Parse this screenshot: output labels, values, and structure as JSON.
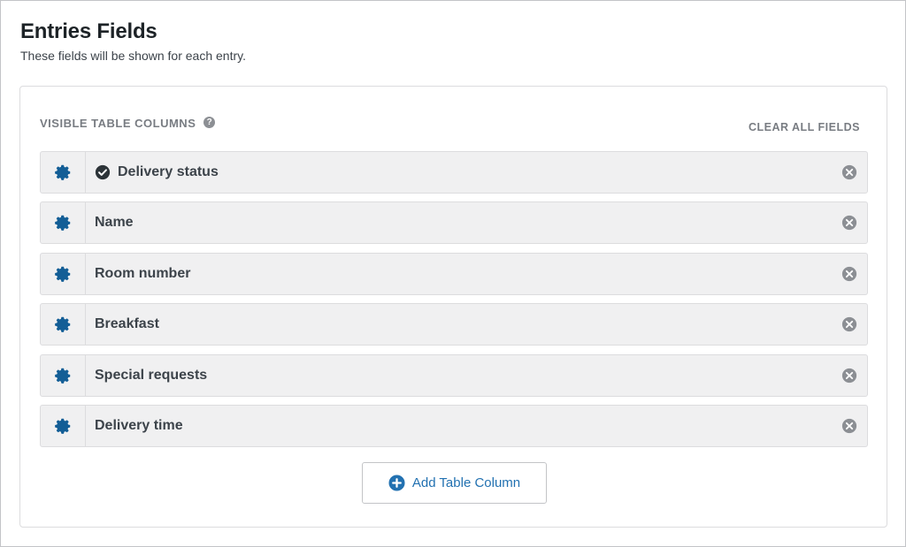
{
  "header": {
    "title": "Entries Fields",
    "description": "These fields will be shown for each entry."
  },
  "panel": {
    "section_label": "VISIBLE TABLE COLUMNS",
    "help_icon": "?",
    "clear_label": "CLEAR ALL FIELDS",
    "rows": [
      {
        "label": "Delivery status",
        "icon": "check-circle-icon"
      },
      {
        "label": "Name"
      },
      {
        "label": "Room number"
      },
      {
        "label": "Breakfast"
      },
      {
        "label": "Special requests"
      },
      {
        "label": "Delivery time"
      }
    ],
    "add_button_label": "Add Table Column"
  },
  "colors": {
    "accent": "#2271b1",
    "cog": "#135e96",
    "row_bg": "#f0f0f1",
    "remove_icon": "#8c8f94"
  }
}
